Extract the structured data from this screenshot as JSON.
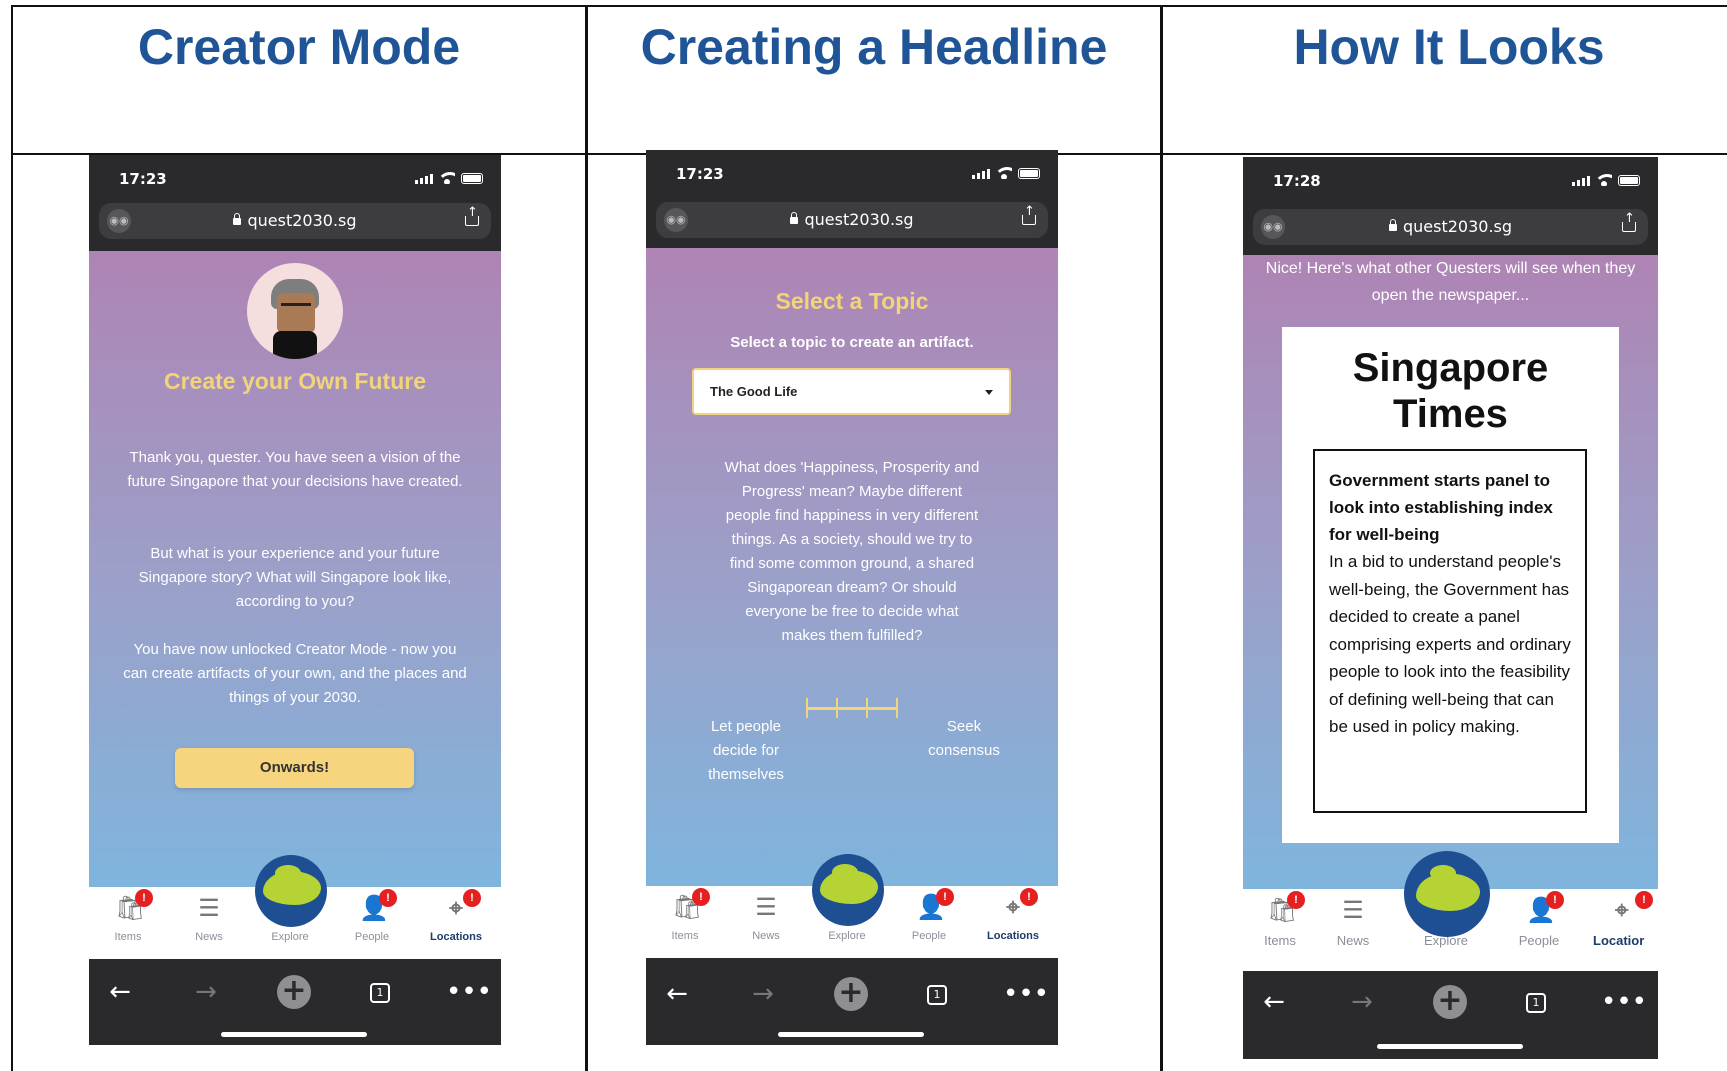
{
  "columns": [
    {
      "title": "Creator Mode"
    },
    {
      "title": "Creating a Headline"
    },
    {
      "title": "How It Looks"
    }
  ],
  "browser": {
    "url": "quest2030.sg",
    "incognito_icon": "incognito-icon",
    "tab_count": "1"
  },
  "nav_labels": {
    "items": "Items",
    "news": "News",
    "explore": "Explore",
    "people": "People",
    "locations": "Locations",
    "locations_truncated": "Locatior"
  },
  "badge": "!",
  "phone1": {
    "time": "17:23",
    "heading": "Create your Own Future",
    "paragraphs": [
      "Thank you, quester. You have seen a vision of the future Singapore that your decisions have created.",
      "But what is your experience and your future Singapore story? What will Singapore look like, according to you?",
      "You have now unlocked Creator Mode - now you can create artifacts of your own, and the places and things of your 2030."
    ],
    "button": "Onwards!"
  },
  "phone2": {
    "time": "17:23",
    "heading": "Select a Topic",
    "subheading": "Select a topic to create an artifact.",
    "select_value": "The Good Life",
    "question": "What does 'Happiness, Prosperity and Progress' mean? Maybe different people find happiness in very different things. As a society, should we try to find some common ground, a shared Singaporean dream? Or should everyone be free to decide what makes them fulfilled?",
    "slider_left": "Let people decide for themselves",
    "slider_right": "Seek consensus"
  },
  "phone3": {
    "time": "17:28",
    "intro": "Nice! Here's what other Questers will see when they open the newspaper...",
    "newspaper_title": "Singapore Times",
    "headline": "Government starts panel to look into establishing index for well-being",
    "body": "In a bid to understand people's well-being, the Government has decided to create a panel comprising experts and ordinary people to look into the feasibility of defining well-being that can be used in policy making."
  },
  "colors": {
    "title_blue": "#1f5597",
    "accent_yellow": "#f1d47c",
    "button_yellow": "#f6d57e",
    "badge_red": "#e52020"
  }
}
